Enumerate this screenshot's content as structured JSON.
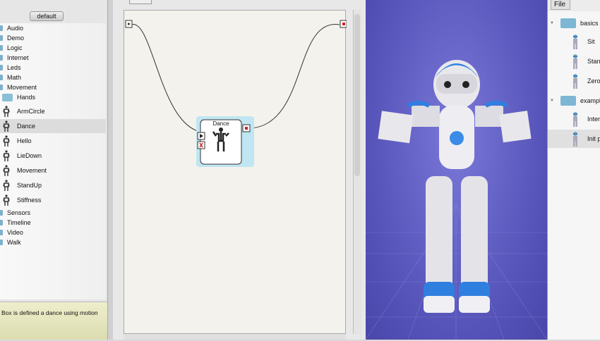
{
  "library": {
    "tab": "default",
    "items": [
      {
        "label": "Audio",
        "kind": "category"
      },
      {
        "label": "Demo",
        "kind": "category"
      },
      {
        "label": "Logic",
        "kind": "category"
      },
      {
        "label": "Internet",
        "kind": "category"
      },
      {
        "label": "Leds",
        "kind": "category"
      },
      {
        "label": "Math",
        "kind": "category"
      },
      {
        "label": "Movement",
        "kind": "category"
      },
      {
        "label": "Hands",
        "kind": "folder"
      },
      {
        "label": "ArmCircle",
        "kind": "box"
      },
      {
        "label": "Dance",
        "kind": "box",
        "selected": true
      },
      {
        "label": "Hello",
        "kind": "box"
      },
      {
        "label": "LieDown",
        "kind": "box"
      },
      {
        "label": "Movement",
        "kind": "box"
      },
      {
        "label": "StandUp",
        "kind": "box"
      },
      {
        "label": "Stiffness",
        "kind": "box"
      },
      {
        "label": "Sensors",
        "kind": "category"
      },
      {
        "label": "Timeline",
        "kind": "category"
      },
      {
        "label": "Video",
        "kind": "category"
      },
      {
        "label": "Walk",
        "kind": "category"
      }
    ],
    "description": "Box is defined a dance using motion"
  },
  "flow": {
    "box_title": "Dance"
  },
  "posture_library": {
    "menu": "File",
    "items": [
      {
        "label": "basics",
        "kind": "folder"
      },
      {
        "label": "Sit",
        "kind": "posture"
      },
      {
        "label": "Stand",
        "kind": "posture"
      },
      {
        "label": "Zero",
        "kind": "posture"
      },
      {
        "label": "examples",
        "kind": "folder"
      },
      {
        "label": "Inter",
        "kind": "posture"
      },
      {
        "label": "Init p",
        "kind": "posture",
        "selected": true
      }
    ]
  },
  "colors": {
    "robot_accent": "#2f7fe0",
    "view_bg": "#5a57c0",
    "desc_bg": "#e6e6c0"
  }
}
